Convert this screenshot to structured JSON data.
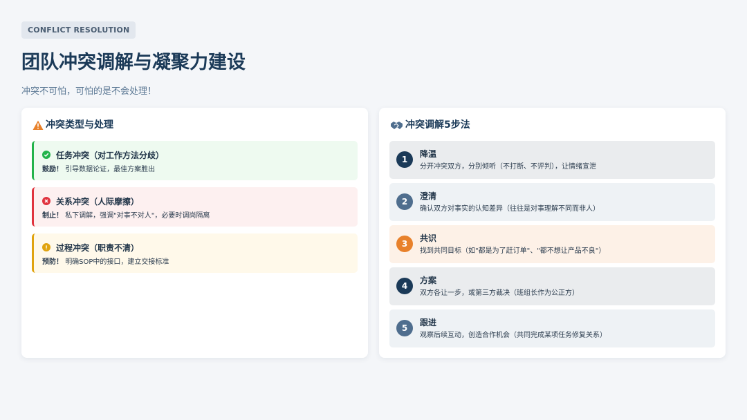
{
  "header": {
    "tag": "CONFLICT RESOLUTION",
    "title": "团队冲突调解与凝聚力建设",
    "subtitle": "冲突不可怕，可怕的是不会处理！"
  },
  "left_card": {
    "title": "冲突类型与处理",
    "icon": "warning-icon",
    "types": [
      {
        "name": "任务冲突（对工作方法分歧）",
        "action_label": "鼓励！",
        "action_text": "引导数据论证，最佳方案胜出",
        "icon": "check-circle-icon",
        "color": "#22b34b",
        "bg": "#eefaf0"
      },
      {
        "name": "关系冲突（人际摩擦）",
        "action_label": "制止！",
        "action_text": "私下调解，强调\"对事不对人\"，必要时调岗隔离",
        "icon": "x-circle-icon",
        "color": "#e0333f",
        "bg": "#fdf0f0"
      },
      {
        "name": "过程冲突（职责不清）",
        "action_label": "预防！",
        "action_text": "明确SOP中的接口，建立交接标准",
        "icon": "alert-circle-icon",
        "color": "#e0a30e",
        "bg": "#fff9ea"
      }
    ]
  },
  "right_card": {
    "title": "冲突调解5步法",
    "icon": "handshake-icon",
    "steps": [
      {
        "num": "1",
        "name": "降温",
        "desc": "分开冲突双方，分别倾听（不打断、不评判），让情绪宣泄",
        "color": "#1b3a58",
        "bg": "#eaecee"
      },
      {
        "num": "2",
        "name": "澄清",
        "desc": "确认双方对事实的认知差异（往往是对事理解不同而非人）",
        "color": "#4f6e8e",
        "bg": "#eef2f5"
      },
      {
        "num": "3",
        "name": "共识",
        "desc": "找到共同目标（如\"都是为了赶订单\"、\"都不想让产品不良\"）",
        "color": "#e8812b",
        "bg": "#fdf1e7"
      },
      {
        "num": "4",
        "name": "方案",
        "desc": "双方各让一步，或第三方裁决（班组长作为公正方）",
        "color": "#1b3a58",
        "bg": "#eaecee"
      },
      {
        "num": "5",
        "name": "跟进",
        "desc": "观察后续互动，创造合作机会（共同完成某项任务修复关系）",
        "color": "#4f6e8e",
        "bg": "#eef2f5"
      }
    ]
  }
}
